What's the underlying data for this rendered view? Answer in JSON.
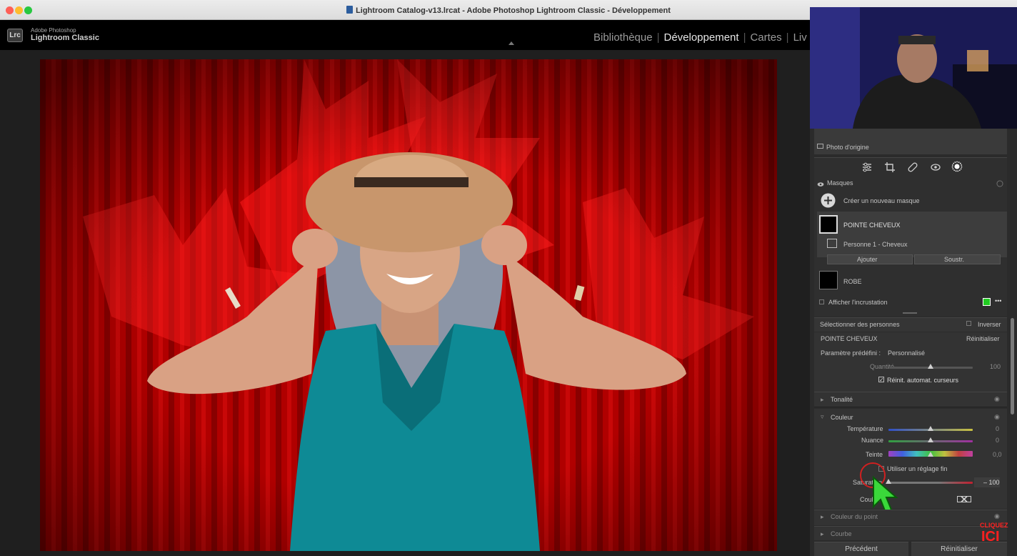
{
  "window": {
    "title": "Lightroom Catalog-v13.lrcat - Adobe Photoshop Lightroom Classic - Développement"
  },
  "app": {
    "logo_text": "Lrc",
    "brand_line1": "Adobe Photoshop",
    "brand_line2": "Lightroom Classic"
  },
  "modules": [
    "Bibliothèque",
    "Développement",
    "Cartes",
    "Liv"
  ],
  "active_module": "Développement",
  "panel": {
    "before_label": "Photo d'origine",
    "masks_header": "Masques",
    "create_mask": "Créer un nouveau masque",
    "masks": [
      {
        "name": "POINTE CHEVEUX",
        "selected": true
      },
      {
        "name": "ROBE",
        "selected": false
      }
    ],
    "submask": "Personne 1 - Cheveux",
    "add_label": "Ajouter",
    "subtract_label": "Soustr.",
    "show_overlay": "Afficher l'incrustation",
    "overlay_color": "#22cc22",
    "select_people": "Sélectionner des personnes",
    "invert": "Inverser",
    "mask_section_title": "POINTE CHEVEUX",
    "reset_label": "Réinitialiser",
    "preset_label": "Paramètre prédéfini :",
    "preset_value": "Personnalisé",
    "amount_label": "Quantité",
    "amount_value": "100",
    "auto_reset": "Réinit. automat. curseurs",
    "tonality": "Tonalité",
    "color_section": "Couleur",
    "temperature": {
      "label": "Température",
      "value": "0",
      "level": 0.5
    },
    "tint": {
      "label": "Nuance",
      "value": "0",
      "level": 0.5
    },
    "hue": {
      "label": "Teinte",
      "value": "0,0",
      "level": 0.5
    },
    "fine_adjust": "Utiliser un réglage fin",
    "saturation": {
      "label": "Saturation",
      "value": "– 100",
      "level": 0.0
    },
    "color_label": "Couleur",
    "point_color": "Couleur du point",
    "curve": "Courbe"
  },
  "buttons": {
    "previous": "Précédent",
    "reset": "Réinitialiser"
  },
  "watermark": {
    "line1": "CLIQUEZ",
    "line2": "ICI"
  },
  "colors": {
    "accent_green": "#22cc22",
    "curtain_red": "#d40000",
    "dress_teal": "#0e8a95"
  }
}
